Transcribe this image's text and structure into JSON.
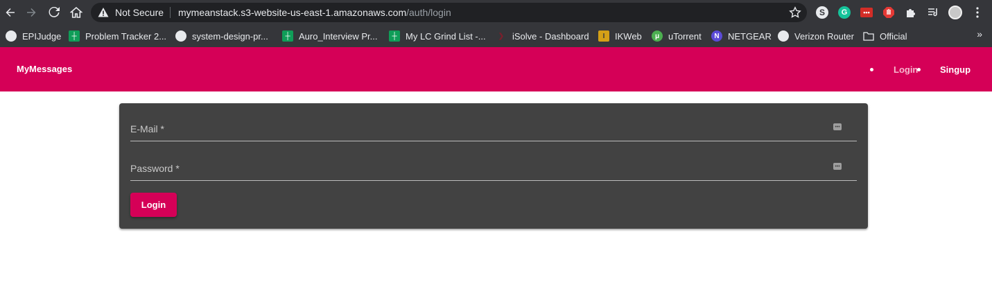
{
  "browser": {
    "security_label": "Not Secure",
    "url_host": "mymeanstack.s3-website-us-east-1.amazonaws.com",
    "url_path": "/auth/login",
    "extensions": [
      "profile-s-icon",
      "grammarly-icon",
      "lastpass-icon",
      "adblock-icon",
      "extensions-puzzle-icon",
      "media-queue-icon"
    ],
    "bookmarks": [
      {
        "label": "EPIJudge",
        "icon": "globe-icon",
        "color": "#e8eaed"
      },
      {
        "label": "Problem Tracker 2...",
        "icon": "sheets-icon",
        "color": "#0f9d58"
      },
      {
        "label": "system-design-pr...",
        "icon": "github-icon",
        "color": "#e8eaed"
      },
      {
        "label": "Auro_Interview Pr...",
        "icon": "sheets-icon",
        "color": "#0f9d58"
      },
      {
        "label": "My LC Grind List -...",
        "icon": "sheets-icon",
        "color": "#0f9d58"
      },
      {
        "label": "iSolve - Dashboard",
        "icon": "isolve-icon",
        "color": "#7a1f2b"
      },
      {
        "label": "IKWeb",
        "icon": "ikweb-icon",
        "color": "#d4a017"
      },
      {
        "label": "uTorrent",
        "icon": "utorrent-icon",
        "color": "#4caf50"
      },
      {
        "label": "NETGEAR",
        "icon": "netgear-icon",
        "color": "#5b4bd6"
      },
      {
        "label": "Verizon Router",
        "icon": "globe-icon",
        "color": "#e8eaed"
      },
      {
        "label": "Official",
        "icon": "folder-icon",
        "color": "#e8eaed"
      }
    ],
    "more_label": "»"
  },
  "app": {
    "brand": "MyMessages",
    "nav": {
      "login": "Login",
      "signup": "Singup"
    },
    "accent": "#d50057"
  },
  "login_form": {
    "email_label": "E-Mail *",
    "email_value": "",
    "password_label": "Password *",
    "password_value": "",
    "submit_label": "Login",
    "card_color": "#424242"
  }
}
